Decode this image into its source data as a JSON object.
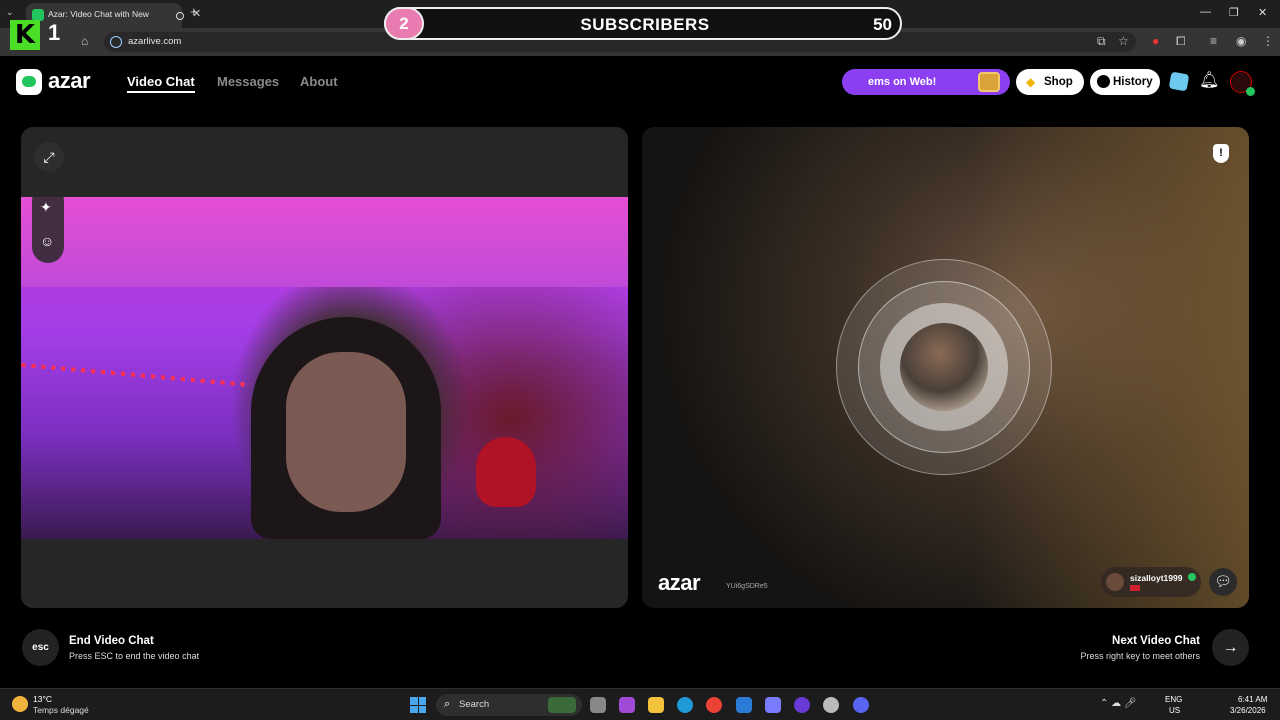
{
  "browser": {
    "tab_title": "Azar: Video Chat with New",
    "url": "azarlive.com"
  },
  "overlay": {
    "logo_letter": "K",
    "logo_number": "1",
    "subscriber_step": "2",
    "subscriber_label": "SUBSCRIBERS",
    "subscriber_count": "50"
  },
  "header": {
    "logo_text": "azar",
    "nav": [
      "Video Chat",
      "Messages",
      "About"
    ],
    "promo_text": "ems on Web!",
    "shop_label": "Shop",
    "history_label": "History"
  },
  "peer": {
    "watermark": "azar",
    "session_id": "YUi6gSDRe5",
    "username": "sizalloyt1999"
  },
  "bottom": {
    "esc_key": "esc",
    "end_title": "End Video Chat",
    "end_subtitle": "Press ESC to end the video chat",
    "next_title": "Next Video Chat",
    "next_subtitle": "Press right key to meet others"
  },
  "taskbar": {
    "temperature": "13°C",
    "weather": "Temps dégagé",
    "search_placeholder": "Search",
    "lang_top": "ENG",
    "lang_bottom": "US",
    "time": "6:41 AM",
    "date": "3/26/2026"
  },
  "colors": {
    "accent_green": "#22c55e",
    "promo_purple": "#8b3ff0",
    "subscriber_pink": "#e87bb0"
  }
}
